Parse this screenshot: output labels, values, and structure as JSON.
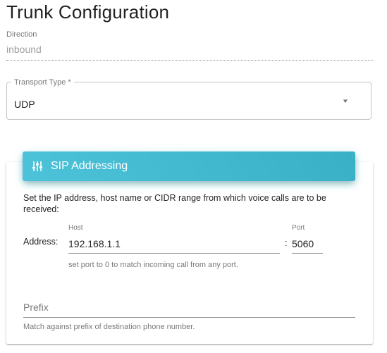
{
  "page": {
    "title": "Trunk Configuration"
  },
  "direction": {
    "label": "Direction",
    "value": "inbound"
  },
  "transport": {
    "label": "Transport Type *",
    "value": "UDP"
  },
  "sip_card": {
    "title": "SIP Addressing",
    "icon": "sliders-icon",
    "accent_color": "#45bad2",
    "description": "Set the IP address, host name or CIDR range from which voice calls are to be received:",
    "address_label": "Address:",
    "host_label": "Host",
    "host_value": "192.168.1.1",
    "separator": ":",
    "port_label": "Port",
    "port_value": "5060",
    "port_hint": "set port to 0 to match incoming call from any port.",
    "prefix_placeholder": "Prefix",
    "prefix_hint": "Match against prefix of destination phone number."
  }
}
